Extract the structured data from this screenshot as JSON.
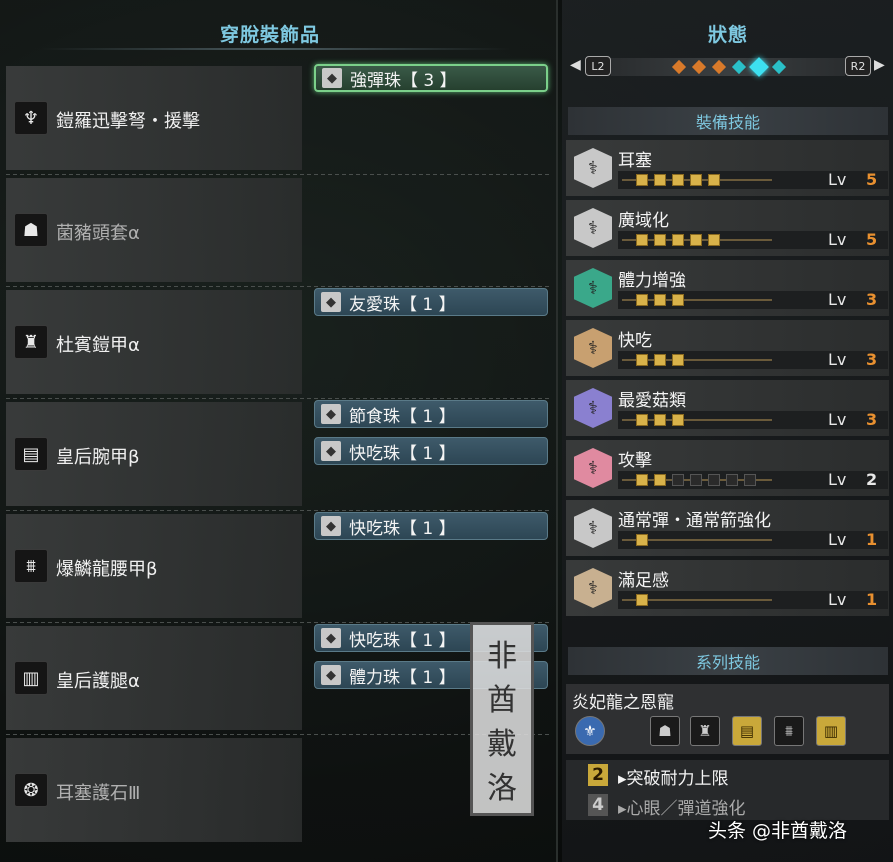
{
  "left_panel": {
    "title": "穿脫裝飾品",
    "equipment": [
      {
        "name": "鎧羅迅擊弩・援擊",
        "icon": "bowgun-icon",
        "decorations": [
          {
            "name": "強彈珠【 3 】",
            "selected": true
          }
        ]
      },
      {
        "name": "菌豬頭套α",
        "icon": "helmet-icon",
        "dim": true,
        "decorations": []
      },
      {
        "name": "杜賓鎧甲α",
        "icon": "chest-armor-icon",
        "decorations": [
          {
            "name": "友愛珠【 1 】"
          }
        ]
      },
      {
        "name": "皇后腕甲β",
        "icon": "gauntlet-icon",
        "decorations": [
          {
            "name": "節食珠【 1 】"
          },
          {
            "name": "快吃珠【 1 】"
          }
        ]
      },
      {
        "name": "爆鱗龍腰甲β",
        "icon": "waist-armor-icon",
        "decorations": [
          {
            "name": "快吃珠【 1 】"
          }
        ]
      },
      {
        "name": "皇后護腿α",
        "icon": "leg-armor-icon",
        "decorations": [
          {
            "name": "快吃珠【 1 】"
          },
          {
            "name": "體力珠【 1 】"
          }
        ]
      },
      {
        "name": "耳塞護石Ⅲ",
        "icon": "charm-icon",
        "dim": true,
        "decorations": []
      }
    ]
  },
  "right_panel": {
    "title": "狀態",
    "l2_label": "L2",
    "r2_label": "R2",
    "equip_skills_header": "裝備技能",
    "lv_label": "Lv",
    "skills": [
      {
        "name": "耳塞",
        "level": 5,
        "max": 5,
        "color": "#c8c8c8"
      },
      {
        "name": "廣域化",
        "level": 5,
        "max": 5,
        "color": "#c8c8c8"
      },
      {
        "name": "體力增強",
        "level": 3,
        "max": 3,
        "color": "#3aa88a"
      },
      {
        "name": "快吃",
        "level": 3,
        "max": 3,
        "color": "#c8a070"
      },
      {
        "name": "最愛菇類",
        "level": 3,
        "max": 3,
        "color": "#8a80d0"
      },
      {
        "name": "攻擊",
        "level": 2,
        "max": 7,
        "color": "#e08aa0"
      },
      {
        "name": "通常彈・通常箭強化",
        "level": 1,
        "max": 1,
        "color": "#c8c8c8"
      },
      {
        "name": "滿足感",
        "level": 1,
        "max": 1,
        "color": "#c8b090"
      }
    ],
    "set_skills_header": "系列技能",
    "set_name": "炎妃龍之恩寵",
    "set_bonuses": [
      {
        "pieces": "2",
        "name": "突破耐力上限",
        "active": true
      },
      {
        "pieces": "4",
        "name": "心眼／彈道強化",
        "active": false
      }
    ]
  },
  "watermark": {
    "chars": [
      "非",
      "酋",
      "戴",
      "洛"
    ]
  },
  "credit": "头条 @非酋戴洛"
}
